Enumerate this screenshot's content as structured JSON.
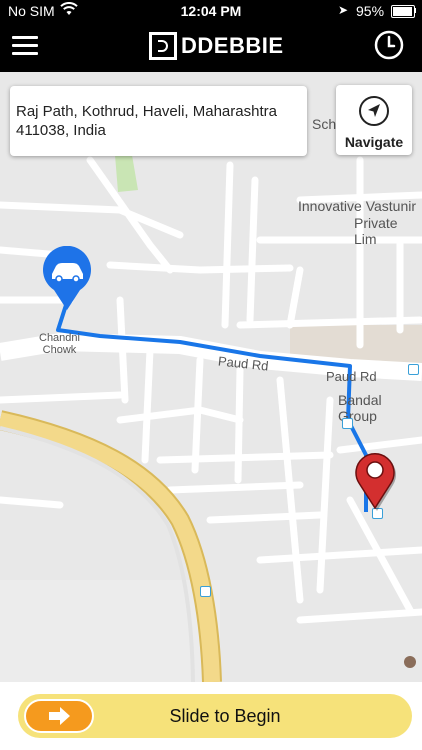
{
  "status_bar": {
    "carrier": "No SIM",
    "time": "12:04 PM",
    "battery": "95%",
    "battery_level": 0.95,
    "icons": [
      "wifi-icon",
      "location-arrow-icon",
      "battery-icon"
    ]
  },
  "app_bar": {
    "logo_text": "DDEBBIE",
    "menu_icon": "hamburger-menu-icon",
    "history_icon": "clock-icon"
  },
  "address_card": {
    "line1": "Raj Path, Kothrud, Haveli, Maharashtra",
    "line2": "411038, India"
  },
  "navigate": {
    "label": "Navigate",
    "icon": "navigation-arrow-icon"
  },
  "map_labels": {
    "chandni_line1": "Chandni",
    "chandni_line2": "Chowk",
    "paud_rd_1": "Paud Rd",
    "paud_rd_2": "Paud Rd",
    "bandal": "Bandal Group",
    "innovative_line1": "Innovative Vastunir",
    "innovative_line2": "Private Lim",
    "school_partial": "Sch"
  },
  "markers": {
    "driver": "car-marker-icon",
    "destination": "destination-pin-icon"
  },
  "colors": {
    "route": "#1976e8",
    "driver_marker": "#1e73e8",
    "destination_marker": "#d32f2f",
    "slider_track": "#f6e27a",
    "slider_knob": "#f59a1e",
    "major_road": "#f2d27a"
  },
  "bottom": {
    "slide_label": "Slide to Begin",
    "knob_icon": "arrow-right-icon"
  }
}
